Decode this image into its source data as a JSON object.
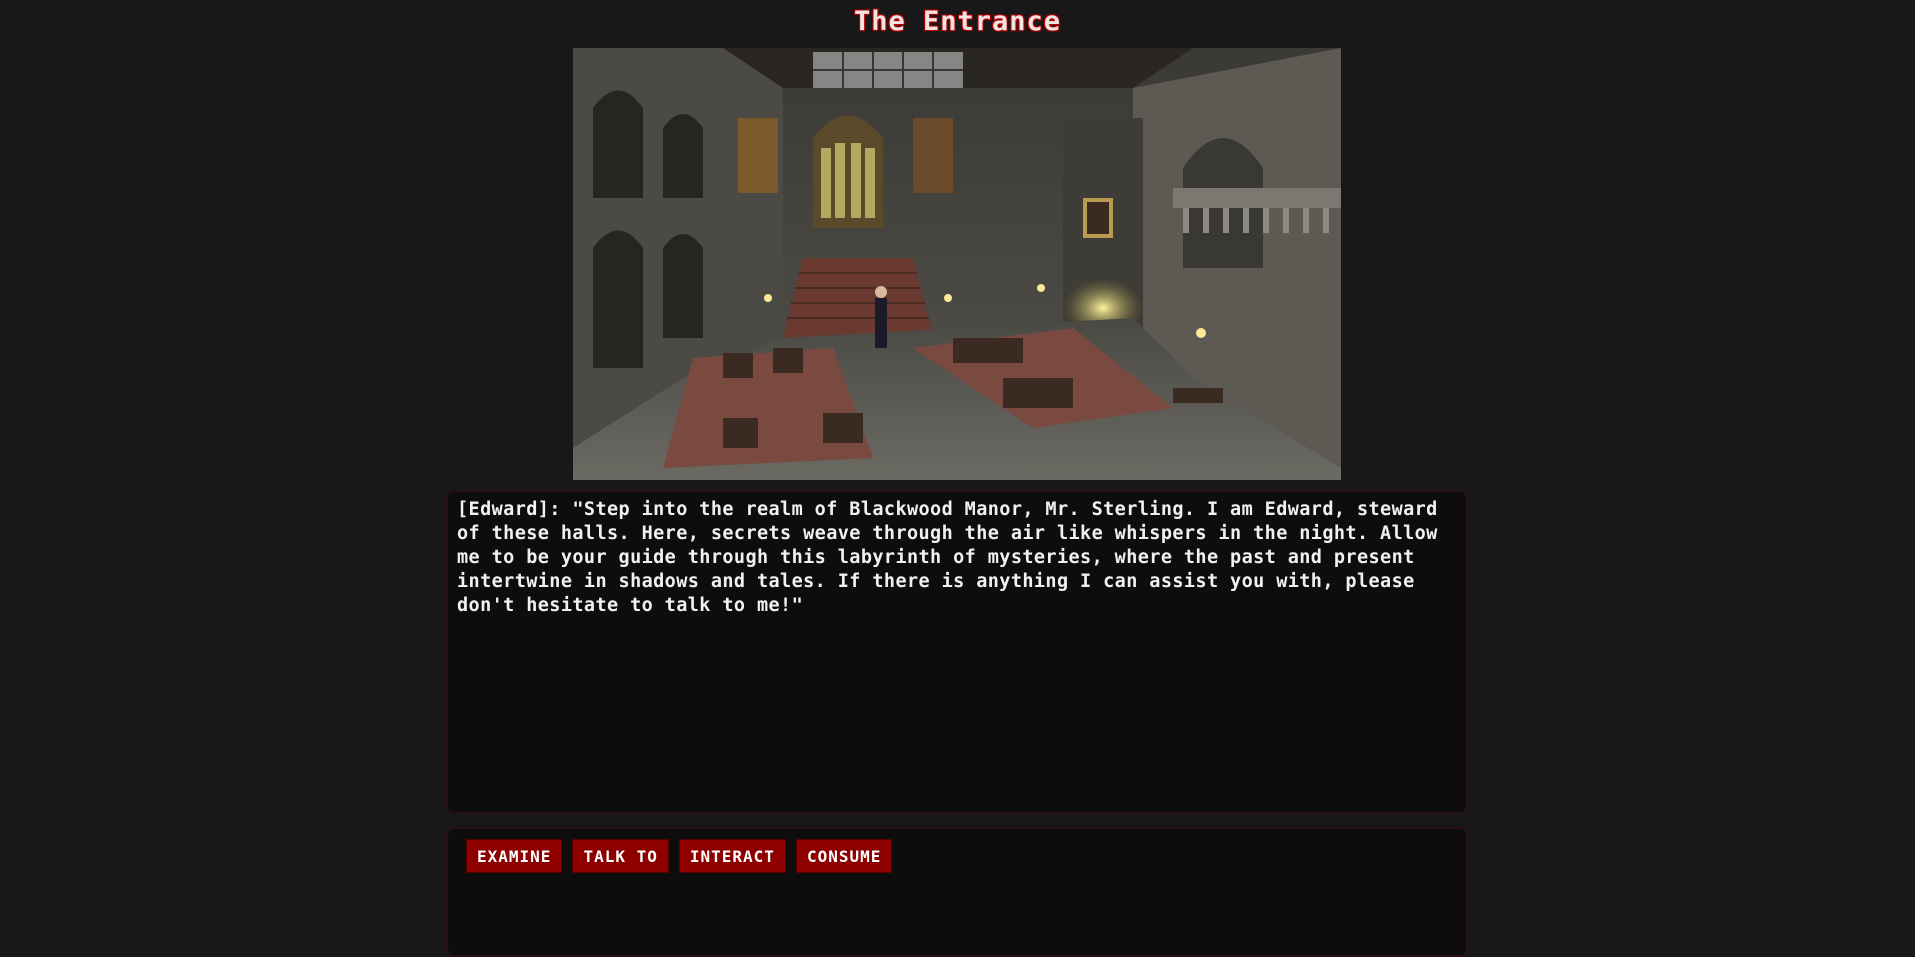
{
  "location": {
    "title": "The Entrance"
  },
  "scene": {
    "icon": "manor-entrance-hall-scene-image"
  },
  "dialog": {
    "text": "[Edward]: \"Step into the realm of Blackwood Manor, Mr. Sterling. I am Edward, steward of these halls. Here, secrets weave through the air like whispers in the night. Allow me to be your guide through this labyrinth of mysteries, where the past and present intertwine in shadows and tales. If there is anything I can assist you with, please don't hesitate to talk to me!\""
  },
  "actions": {
    "examine": "EXAMINE",
    "talk_to": "TALK TO",
    "interact": "INTERACT",
    "consume": "CONSUME"
  },
  "colors": {
    "background": "#181818",
    "panel": "#0d0d0d",
    "button": "#8e0000",
    "text": "#f1f1f1"
  }
}
